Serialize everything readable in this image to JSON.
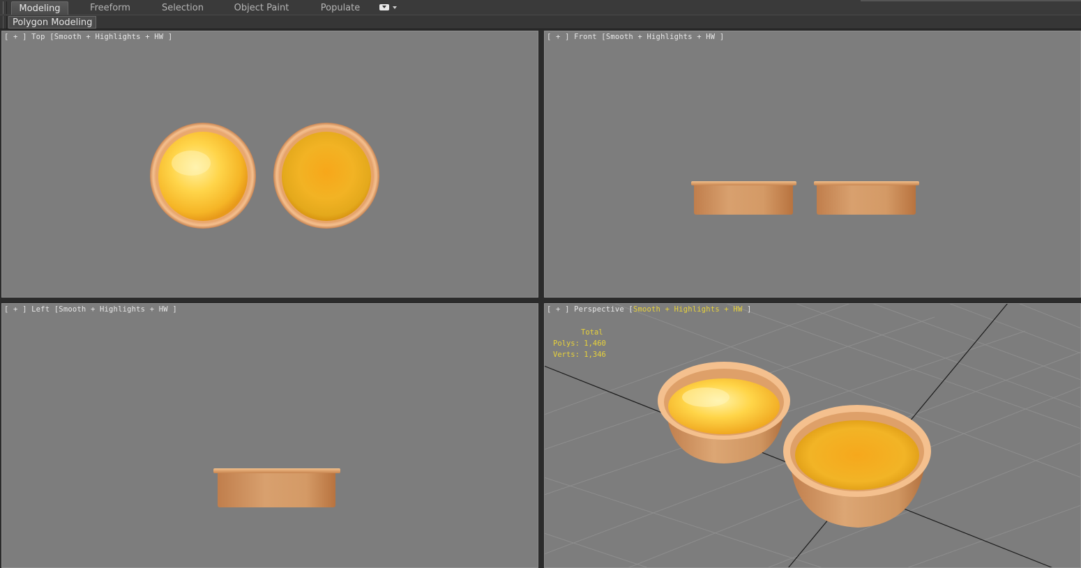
{
  "ribbon": {
    "tabs": [
      {
        "label": "Modeling",
        "active": true
      },
      {
        "label": "Freeform",
        "active": false
      },
      {
        "label": "Selection",
        "active": false
      },
      {
        "label": "Object Paint",
        "active": false
      },
      {
        "label": "Populate",
        "active": false
      }
    ],
    "panel_label": "Polygon Modeling"
  },
  "viewports": {
    "top": {
      "plus": "[ + ]",
      "name": "Top",
      "shading": "Smooth + Highlights + HW",
      "close": "]"
    },
    "front": {
      "plus": "[ + ]",
      "name": "Front",
      "shading": "Smooth + Highlights + HW",
      "close": "]"
    },
    "left": {
      "plus": "[ + ]",
      "name": "Left",
      "shading": "Smooth + Highlights + HW",
      "close": "]"
    },
    "perspective": {
      "plus": "[ + ]",
      "name": "Perspective",
      "shading": "Smooth + Highlights + HW",
      "close": "]"
    }
  },
  "stats": {
    "title": "Total",
    "polys": "Polys: 1,460",
    "verts": "Verts: 1,346"
  },
  "colors": {
    "viewport_bg": "#7d7d7d",
    "crust": "#d89a64",
    "filling_glossy": "#ffcc33",
    "filling_baked": "#f0a818",
    "highlight_text": "#e8d23a"
  }
}
